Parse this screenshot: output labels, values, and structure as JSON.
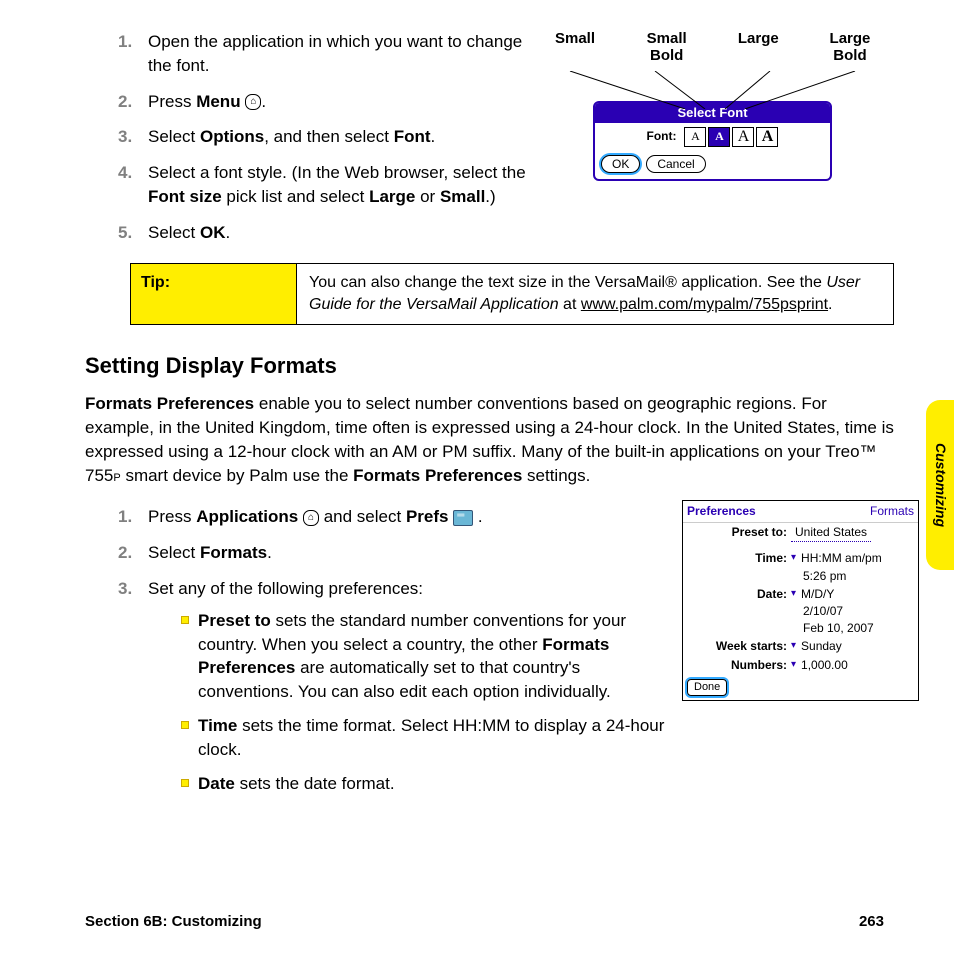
{
  "sideTab": "Customizing",
  "stepsA": {
    "s1": "Open the application in which you want to change the font.",
    "s2a": "Press ",
    "s2b": "Menu",
    "s2c": " ",
    "s2icon": "⌂",
    "s2d": ".",
    "s3a": "Select ",
    "s3b": "Options",
    "s3c": ", and then select ",
    "s3d": "Font",
    "s3e": ".",
    "s4a": "Select a font style. (In the Web browser, select the ",
    "s4b": "Font size",
    "s4c": " pick list and select ",
    "s4d": "Large",
    "s4e": " or ",
    "s4f": "Small",
    "s4g": ".)",
    "s5a": "Select ",
    "s5b": "OK",
    "s5c": "."
  },
  "fontLabels": {
    "a": "Small",
    "b": "Small Bold",
    "c": "Large",
    "d": "Large Bold"
  },
  "selectFont": {
    "title": "Select Font",
    "rowLabel": "Font:",
    "opt1": "A",
    "opt2": "A",
    "opt3": "A",
    "opt4": "A",
    "ok": "OK",
    "cancel": "Cancel"
  },
  "tip": {
    "label": "Tip:",
    "body1": "You can also change the text size in the VersaMail® application. See the ",
    "em": "User Guide for the VersaMail Application",
    "body2": " at ",
    "link": "www.palm.com/mypalm/755psprint",
    "body3": "."
  },
  "h2": "Setting Display Formats",
  "para": {
    "p1a": "Formats Preferences",
    "p1b": " enable you to select number conventions based on geographic regions. For example, in the United Kingdom, time often is expressed using a 24-hour clock. In the United States, time is expressed using a 12-hour clock with an AM or PM suffix. Many of the built-in applications on your Treo™ 755",
    "p1sub": "P",
    "p1c": " smart device by Palm use the ",
    "p1d": "Formats Preferences",
    "p1e": " settings."
  },
  "stepsB": {
    "s1a": "Press ",
    "s1b": "Applications",
    "s1icon1": "⌂",
    "s1c": " and select ",
    "s1d": "Prefs",
    "s1e": " .",
    "s2a": "Select ",
    "s2b": "Formats",
    "s2c": ".",
    "s3": "Set any of the following preferences:",
    "bullet1a": "Preset to",
    "bullet1b": " sets the standard number conventions for your country. When you select a country, the other ",
    "bullet1c": "Formats Preferences",
    "bullet1d": " are automatically set to that country's conventions. You can also edit each option individually.",
    "bullet2a": "Time",
    "bullet2b": " sets the time format. Select HH:MM to display a 24-hour clock.",
    "bullet3a": "Date",
    "bullet3b": " sets the date format."
  },
  "prefs": {
    "headerLeft": "Preferences",
    "headerRight": "Formats",
    "presetLabel": "Preset to:",
    "presetVal": "United States",
    "timeLabel": "Time:",
    "timeVal": "HH:MM am/pm",
    "timeExample": "5:26 pm",
    "dateLabel": "Date:",
    "dateVal": "M/D/Y",
    "dateEx1": "2/10/07",
    "dateEx2": "Feb 10, 2007",
    "weekLabel": "Week starts:",
    "weekVal": "Sunday",
    "numLabel": "Numbers:",
    "numVal": "1,000.00",
    "done": "Done"
  },
  "footer": {
    "left": "Section 6B: Customizing",
    "right": "263"
  }
}
